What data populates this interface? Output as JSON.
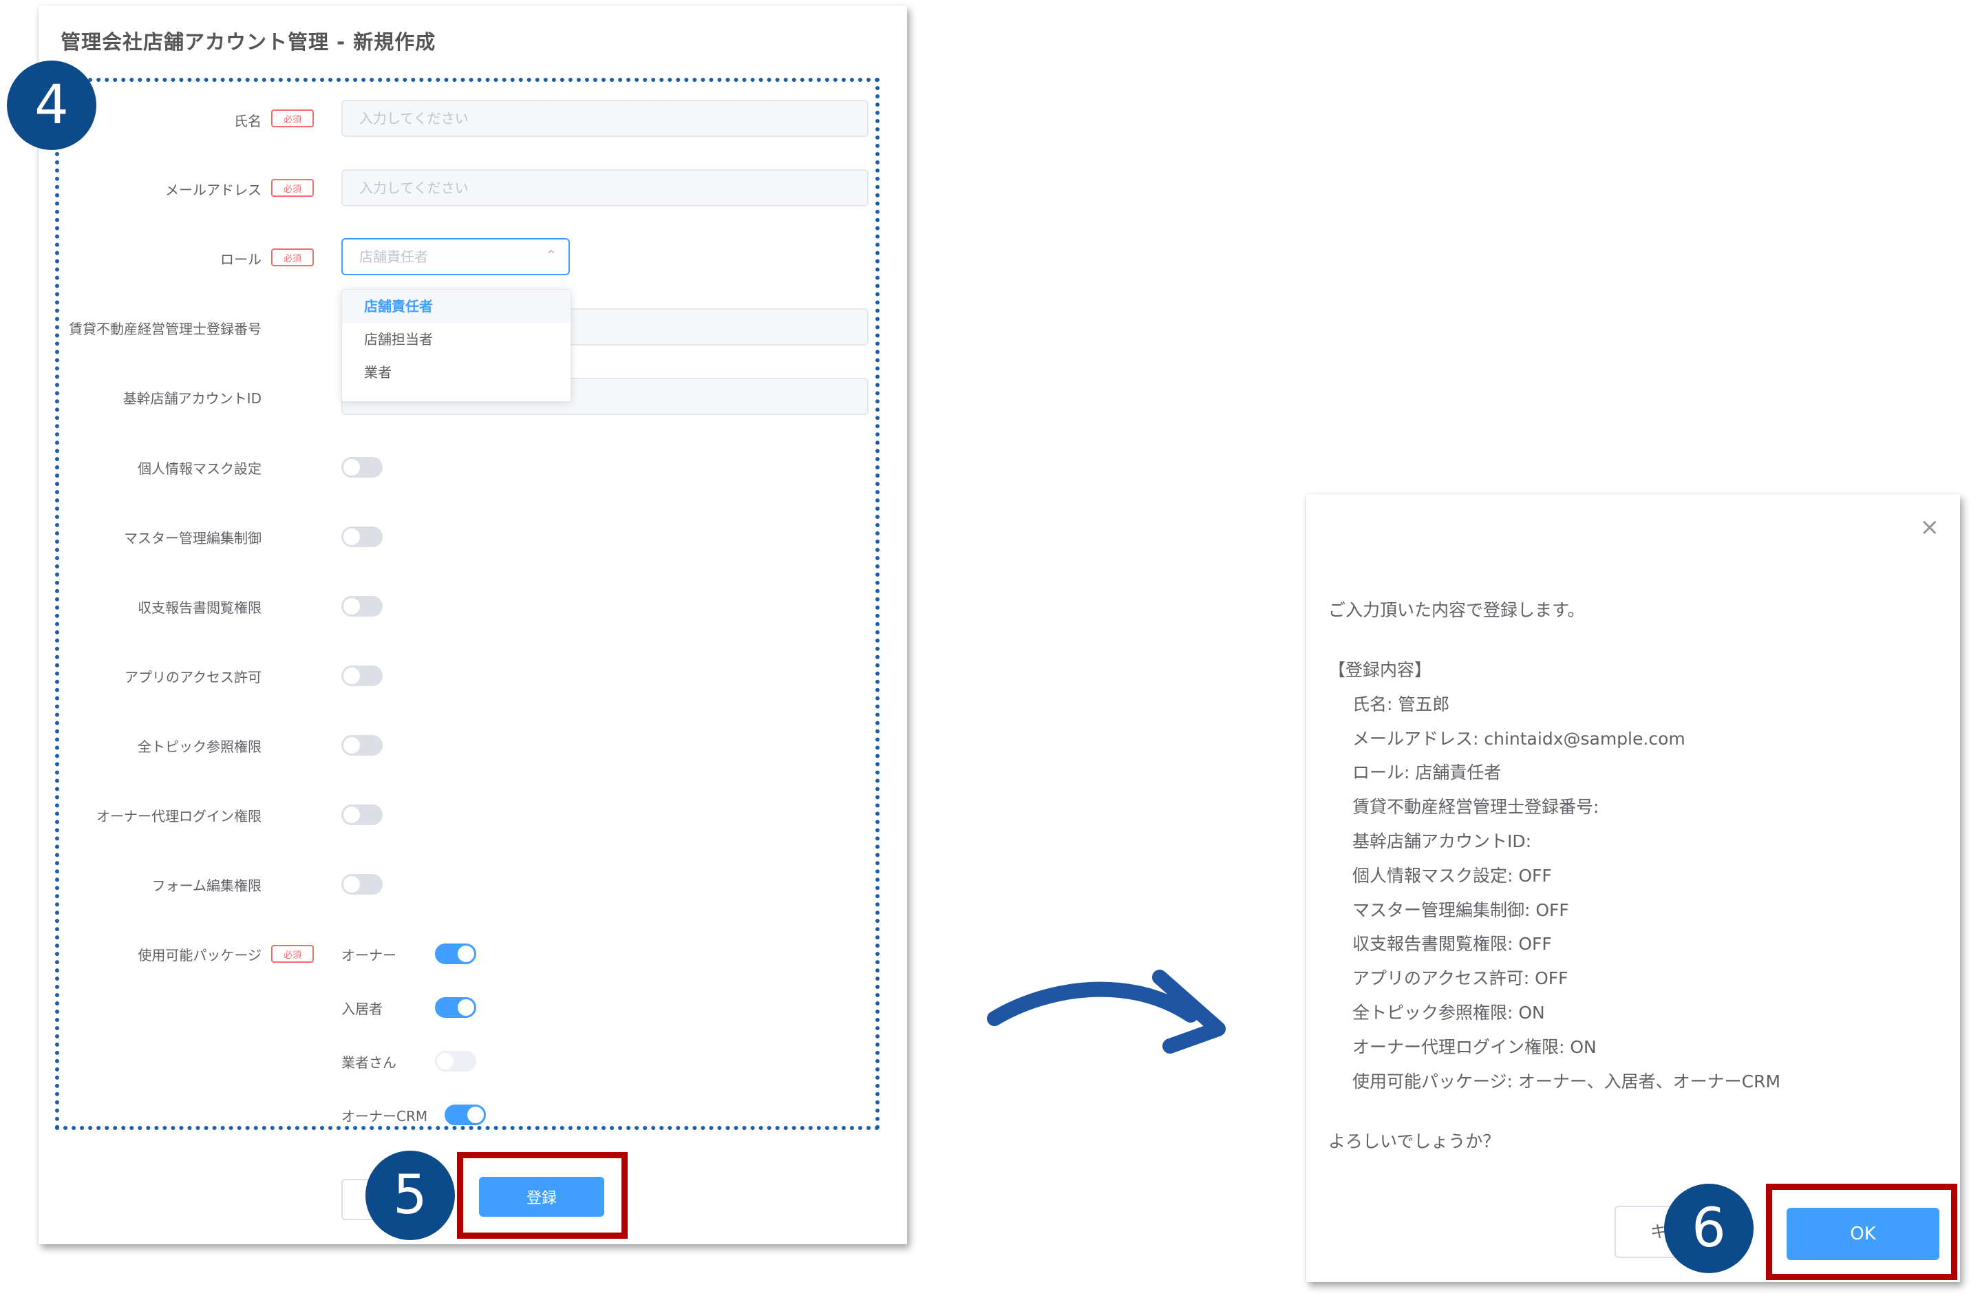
{
  "form": {
    "title": "管理会社店舗アカウント管理 - 新規作成",
    "required_tag": "必須",
    "fields": {
      "name_label": "氏名",
      "name_placeholder": "入力してください",
      "email_label": "メールアドレス",
      "email_placeholder": "入力してください",
      "role_label": "ロール",
      "role_value": "店舗責任者",
      "license_label": "賃貸不動産経営管理士登録番号",
      "base_id_label": "基幹店舗アカウントID"
    },
    "role_options": [
      "店舗責任者",
      "店舗担当者",
      "業者"
    ],
    "toggles": [
      {
        "label": "個人情報マスク設定",
        "on": false
      },
      {
        "label": "マスター管理編集制御",
        "on": false
      },
      {
        "label": "収支報告書閲覧権限",
        "on": false
      },
      {
        "label": "アプリのアクセス許可",
        "on": false
      },
      {
        "label": "全トピック参照権限",
        "on": false
      },
      {
        "label": "オーナー代理ログイン権限",
        "on": false
      },
      {
        "label": "フォーム編集権限",
        "on": false
      }
    ],
    "packages_label": "使用可能パッケージ",
    "packages": [
      {
        "label": "オーナー",
        "on": true
      },
      {
        "label": "入居者",
        "on": true
      },
      {
        "label": "業者さん",
        "on": false,
        "disabled": true
      },
      {
        "label": "オーナーCRM",
        "on": true
      }
    ],
    "submit_label": "登録"
  },
  "dialog": {
    "intro": "ご入力頂いた内容で登録します。",
    "section_title": "【登録内容】",
    "lines": [
      "氏名: 管五郎",
      "メールアドレス: chintaidx@sample.com",
      "ロール: 店舗責任者",
      "賃貸不動産経営管理士登録番号:",
      "基幹店舗アカウントID:",
      "個人情報マスク設定: OFF",
      "マスター管理編集制御: OFF",
      "収支報告書閲覧権限: OFF",
      "アプリのアクセス許可: OFF",
      "全トピック参照権限: ON",
      "オーナー代理ログイン権限: ON",
      "使用可能パッケージ: オーナー、入居者、オーナーCRM"
    ],
    "question": "よろしいでしょうか？",
    "cancel_label": "キ",
    "ok_label": "OK",
    "close_icon": "×"
  },
  "steps": {
    "step4": "4",
    "step5": "5",
    "step6": "6"
  },
  "colors": {
    "primary": "#409eff",
    "badge": "#0d4a8a",
    "highlight": "#b00000",
    "required": "#f56c6c"
  }
}
